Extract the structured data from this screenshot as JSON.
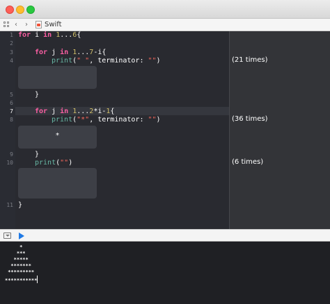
{
  "window": {
    "traffic_lights": {
      "close": "#fd5f57",
      "minimize": "#febc2e",
      "zoom": "#29c840"
    }
  },
  "jump_bar": {
    "grid_icon": "grid-icon",
    "back": "‹",
    "forward": "›",
    "file_icon": "swift-file-icon",
    "file_name": "Swift"
  },
  "editor": {
    "line_numbers": [
      "1",
      "2",
      "3",
      "4",
      "5",
      "6",
      "7",
      "8",
      "9",
      "10",
      "11"
    ],
    "lines": {
      "l1": {
        "kw1": "for",
        "t1": " i ",
        "kw2": "in",
        "t2": " ",
        "n1": "1",
        "t3": "...",
        "n2": "6",
        "t4": "{"
      },
      "l3": {
        "kw1": "for",
        "t1": " j ",
        "kw2": "in",
        "t2": " ",
        "n1": "1",
        "t3": "...",
        "n2": "7",
        "t4": "-i{"
      },
      "l4": {
        "fn": "print",
        "t1": "(",
        "s1": "\" \"",
        "t2": ", terminator: ",
        "s2": "\"\"",
        "t3": ")"
      },
      "l5": {
        "t1": "}"
      },
      "l7": {
        "kw1": "for",
        "t1": " j ",
        "kw2": "in",
        "t2": " ",
        "n1": "1",
        "t3": "...",
        "n2": "2",
        "t4": "*i-",
        "n3": "1",
        "t5": "{"
      },
      "l8": {
        "fn": "print",
        "t1": "(",
        "s1": "\"*\"",
        "t2": ", terminator: ",
        "s2": "\"\"",
        "t3": ")"
      },
      "l9": {
        "t1": "}"
      },
      "l10": {
        "fn": "print",
        "t1": "(",
        "s1": "\"\"",
        "t2": ")"
      },
      "l11": {
        "t1": "}"
      }
    },
    "inline_results": [
      "",
      "*",
      ""
    ],
    "sidebar_results": [
      "(21 times)",
      "(36 times)",
      "(6 times)"
    ]
  },
  "debug_bar": {
    "hide_icon": "hide-debug-area-icon",
    "run_icon": "play-icon",
    "run_color": "#1f7ae6"
  },
  "console": {
    "output": "     *\n    ***\n   *****\n  *******\n *********\n***********"
  }
}
